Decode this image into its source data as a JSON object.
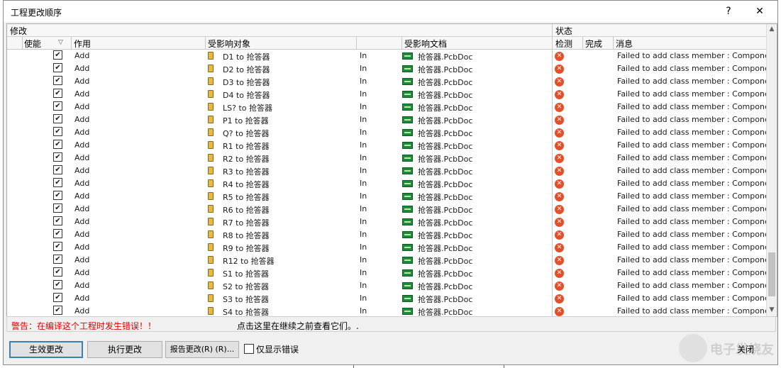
{
  "window": {
    "title": "工程更改顺序",
    "help_label": "?",
    "close_label": "✕"
  },
  "groups": {
    "modify": "修改",
    "status": "状态"
  },
  "columns": {
    "enable": "使能",
    "sort_mark": "▽",
    "action": "作用",
    "affected_object": "受影响对象",
    "affected_doc": "受影响文档",
    "check": "检测",
    "done": "完成",
    "message": "消息"
  },
  "rows": [
    {
      "checked": "✔",
      "action": "Add",
      "object": "D1 to 抢答器",
      "dir": "In",
      "doc": "抢答器.PcbDoc",
      "check": "✕",
      "message": "Failed to add class member : Component"
    },
    {
      "checked": "✔",
      "action": "Add",
      "object": "D2 to 抢答器",
      "dir": "In",
      "doc": "抢答器.PcbDoc",
      "check": "✕",
      "message": "Failed to add class member : Component"
    },
    {
      "checked": "✔",
      "action": "Add",
      "object": "D3 to 抢答器",
      "dir": "In",
      "doc": "抢答器.PcbDoc",
      "check": "✕",
      "message": "Failed to add class member : Component"
    },
    {
      "checked": "✔",
      "action": "Add",
      "object": "D4 to 抢答器",
      "dir": "In",
      "doc": "抢答器.PcbDoc",
      "check": "✕",
      "message": "Failed to add class member : Component"
    },
    {
      "checked": "✔",
      "action": "Add",
      "object": "LS? to 抢答器",
      "dir": "In",
      "doc": "抢答器.PcbDoc",
      "check": "✕",
      "message": "Failed to add class member : Component"
    },
    {
      "checked": "✔",
      "action": "Add",
      "object": "P1 to 抢答器",
      "dir": "In",
      "doc": "抢答器.PcbDoc",
      "check": "✕",
      "message": "Failed to add class member : Component"
    },
    {
      "checked": "✔",
      "action": "Add",
      "object": "Q? to 抢答器",
      "dir": "In",
      "doc": "抢答器.PcbDoc",
      "check": "✕",
      "message": "Failed to add class member : Component"
    },
    {
      "checked": "✔",
      "action": "Add",
      "object": "R1 to 抢答器",
      "dir": "In",
      "doc": "抢答器.PcbDoc",
      "check": "✕",
      "message": "Failed to add class member : Component"
    },
    {
      "checked": "✔",
      "action": "Add",
      "object": "R2 to 抢答器",
      "dir": "In",
      "doc": "抢答器.PcbDoc",
      "check": "✕",
      "message": "Failed to add class member : Component"
    },
    {
      "checked": "✔",
      "action": "Add",
      "object": "R3 to 抢答器",
      "dir": "In",
      "doc": "抢答器.PcbDoc",
      "check": "✕",
      "message": "Failed to add class member : Component"
    },
    {
      "checked": "✔",
      "action": "Add",
      "object": "R4 to 抢答器",
      "dir": "In",
      "doc": "抢答器.PcbDoc",
      "check": "✕",
      "message": "Failed to add class member : Component"
    },
    {
      "checked": "✔",
      "action": "Add",
      "object": "R5 to 抢答器",
      "dir": "In",
      "doc": "抢答器.PcbDoc",
      "check": "✕",
      "message": "Failed to add class member : Component"
    },
    {
      "checked": "✔",
      "action": "Add",
      "object": "R6 to 抢答器",
      "dir": "In",
      "doc": "抢答器.PcbDoc",
      "check": "✕",
      "message": "Failed to add class member : Component"
    },
    {
      "checked": "✔",
      "action": "Add",
      "object": "R7 to 抢答器",
      "dir": "In",
      "doc": "抢答器.PcbDoc",
      "check": "✕",
      "message": "Failed to add class member : Component"
    },
    {
      "checked": "✔",
      "action": "Add",
      "object": "R8 to 抢答器",
      "dir": "In",
      "doc": "抢答器.PcbDoc",
      "check": "✕",
      "message": "Failed to add class member : Component"
    },
    {
      "checked": "✔",
      "action": "Add",
      "object": "R9 to 抢答器",
      "dir": "In",
      "doc": "抢答器.PcbDoc",
      "check": "✕",
      "message": "Failed to add class member : Component"
    },
    {
      "checked": "✔",
      "action": "Add",
      "object": "R12 to 抢答器",
      "dir": "In",
      "doc": "抢答器.PcbDoc",
      "check": "✕",
      "message": "Failed to add class member : Component"
    },
    {
      "checked": "✔",
      "action": "Add",
      "object": "S1 to 抢答器",
      "dir": "In",
      "doc": "抢答器.PcbDoc",
      "check": "✕",
      "message": "Failed to add class member : Component"
    },
    {
      "checked": "✔",
      "action": "Add",
      "object": "S2 to 抢答器",
      "dir": "In",
      "doc": "抢答器.PcbDoc",
      "check": "✕",
      "message": "Failed to add class member : Component"
    },
    {
      "checked": "✔",
      "action": "Add",
      "object": "S3 to 抢答器",
      "dir": "In",
      "doc": "抢答器.PcbDoc",
      "check": "✕",
      "message": "Failed to add class member : Component"
    },
    {
      "checked": "✔",
      "action": "Add",
      "object": "S4 to 抢答器",
      "dir": "In",
      "doc": "抢答器.PcbDoc",
      "check": "✕",
      "message": "Failed to add class member : Component"
    }
  ],
  "status_bar": {
    "warning": "警告：在编译这个工程时发生错误！！",
    "hint": "点击这里在继续之前查看它们。."
  },
  "buttons": {
    "validate": "生效更改",
    "execute": "执行更改",
    "report": "报告更改(R) (R)...",
    "show_errors_only": "仅显示错误",
    "close": "关闭"
  },
  "scrollbar": {
    "up": "▲",
    "down": "▼"
  },
  "watermark": "电子发烧友",
  "colors": {
    "warning": "#e00000",
    "error_icon": "#e2502a",
    "default_button_border": "#3c7fb1"
  }
}
